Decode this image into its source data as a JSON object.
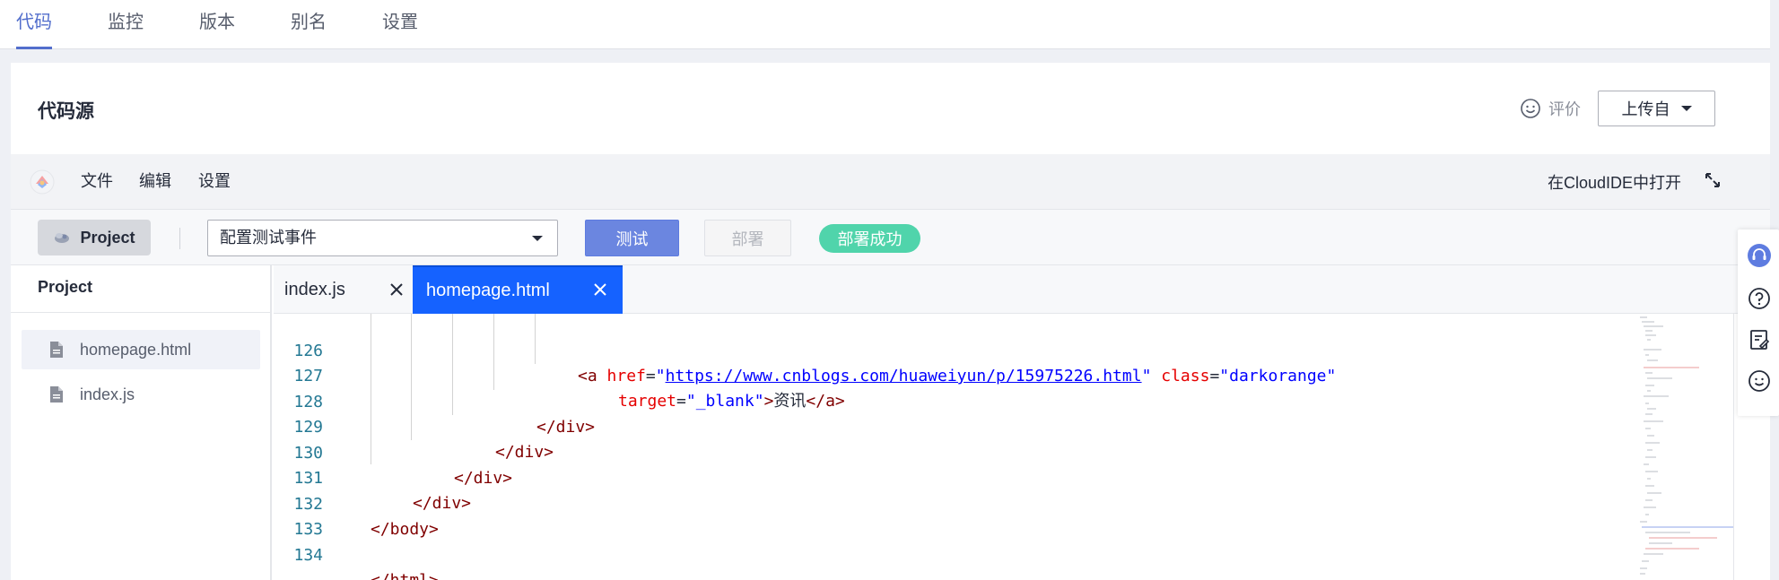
{
  "top_tabs": [
    {
      "label": "代码",
      "active": true
    },
    {
      "label": "监控",
      "active": false
    },
    {
      "label": "版本",
      "active": false
    },
    {
      "label": "别名",
      "active": false
    },
    {
      "label": "设置",
      "active": false
    }
  ],
  "card": {
    "title": "代码源",
    "rate_label": "评价",
    "upload_label": "上传自"
  },
  "ide": {
    "menu": [
      "文件",
      "编辑",
      "设置"
    ],
    "open_in_cloudide": "在CloudIDE中打开",
    "toolbar": {
      "project_label": "Project",
      "test_event_value": "配置测试事件",
      "test_label": "测试",
      "deploy_label": "部署",
      "status": "部署成功"
    },
    "explorer": {
      "title": "Project",
      "files": [
        "homepage.html",
        "index.js"
      ]
    },
    "tabs": [
      {
        "label": "index.js",
        "active": false
      },
      {
        "label": "homepage.html",
        "active": true
      }
    ],
    "code_lines": [
      {
        "num": "126",
        "tokens": [
          "<a",
          " href",
          "=",
          "\"",
          "https://www.cnblogs.com/huaweiyun/p/15975226.html",
          "\"",
          " class",
          "=",
          "\"darkorange\""
        ]
      },
      {
        "num": "127",
        "tokens": [
          "target",
          "=",
          "\"_blank\"",
          ">",
          "资讯",
          "</a>"
        ]
      },
      {
        "num": "128",
        "tokens": [
          "</div>"
        ]
      },
      {
        "num": "129",
        "tokens": [
          "</div>"
        ]
      },
      {
        "num": "130",
        "tokens": [
          "</div>"
        ]
      },
      {
        "num": "131",
        "tokens": [
          "</div>"
        ]
      },
      {
        "num": "132",
        "tokens": [
          "</body>"
        ]
      },
      {
        "num": "133",
        "tokens": []
      },
      {
        "num": "134",
        "tokens": [
          "</html>"
        ]
      }
    ]
  },
  "colors": {
    "accent": "#526ecc",
    "active_tab": "#1562ff",
    "test_button": "#6b86e0",
    "status_pill": "#50d4ab",
    "line_number": "#237893",
    "tag": "#800000",
    "attr": "#e50000",
    "string": "#0000ff"
  },
  "icons": {
    "rate": "smile-icon",
    "expand": "expand-icon",
    "file": "file-icon",
    "close": "close-icon",
    "float": [
      "headset-icon",
      "help-icon",
      "feedback-icon",
      "emoji-icon"
    ]
  }
}
